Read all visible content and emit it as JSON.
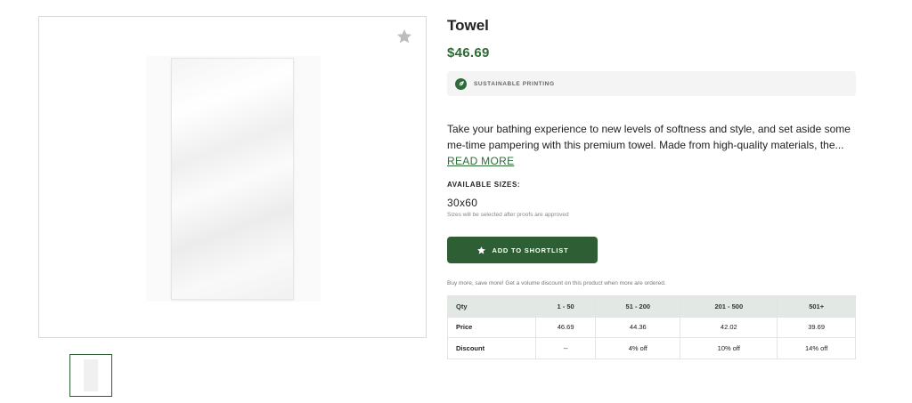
{
  "gallery": {
    "favorite_icon": "star-icon",
    "thumbnails": [
      "towel-thumbnail"
    ]
  },
  "product": {
    "title": "Towel",
    "price": "$46.69",
    "badge": {
      "icon": "leaf-icon",
      "label": "SUSTAINABLE PRINTING"
    },
    "description": "Take your bathing experience to new levels of softness and style, and set aside some me-time pampering with this premium towel. Made from high-quality materials, the...",
    "read_more": "READ MORE",
    "sizes_label": "AVAILABLE SIZES:",
    "size_value": "30x60",
    "size_note": "Sizes will be selected after proofs are approved",
    "shortlist_button": {
      "icon": "star-icon",
      "label": "ADD TO SHORTLIST"
    },
    "volume_note": "Buy more, save more! Get a volume discount on this product when more are ordered."
  },
  "pricing_table": {
    "header": [
      "Qty",
      "1 - 50",
      "51 - 200",
      "201 - 500",
      "501+"
    ],
    "rows": [
      [
        "Price",
        "46.69",
        "44.36",
        "42.02",
        "39.69"
      ],
      [
        "Discount",
        "--",
        "4% off",
        "10% off",
        "14% off"
      ]
    ]
  },
  "colors": {
    "brand_green": "#2e5e34",
    "price_green": "#2e6b38",
    "table_header_bg": "#e2e8e4"
  }
}
